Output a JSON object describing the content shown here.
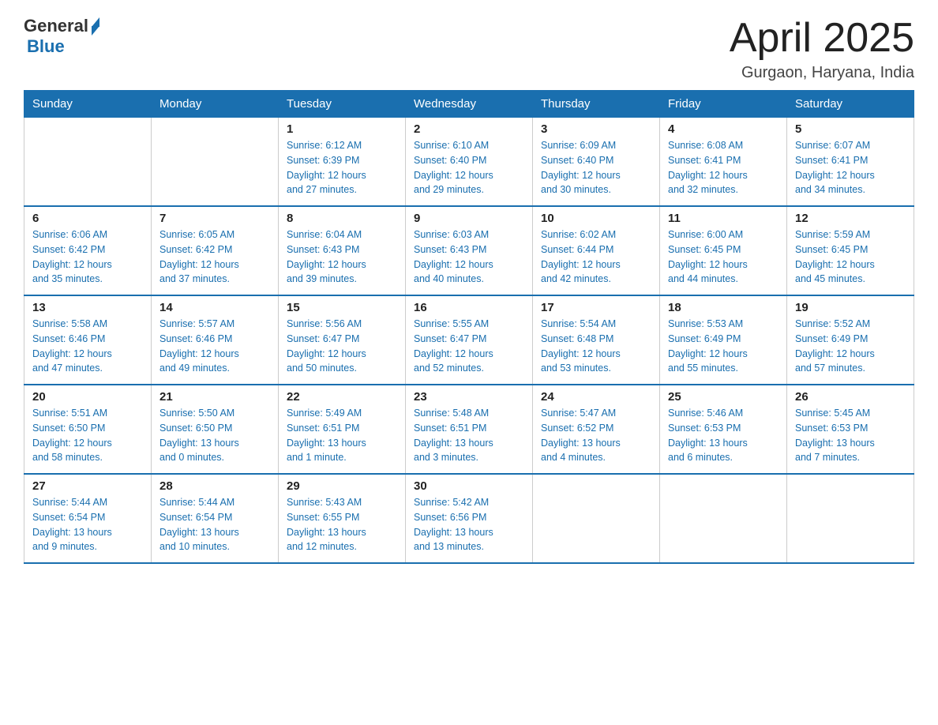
{
  "logo": {
    "general": "General",
    "blue": "Blue"
  },
  "header": {
    "month": "April 2025",
    "location": "Gurgaon, Haryana, India"
  },
  "weekdays": [
    "Sunday",
    "Monday",
    "Tuesday",
    "Wednesday",
    "Thursday",
    "Friday",
    "Saturday"
  ],
  "weeks": [
    [
      {
        "day": "",
        "info": ""
      },
      {
        "day": "",
        "info": ""
      },
      {
        "day": "1",
        "info": "Sunrise: 6:12 AM\nSunset: 6:39 PM\nDaylight: 12 hours\nand 27 minutes."
      },
      {
        "day": "2",
        "info": "Sunrise: 6:10 AM\nSunset: 6:40 PM\nDaylight: 12 hours\nand 29 minutes."
      },
      {
        "day": "3",
        "info": "Sunrise: 6:09 AM\nSunset: 6:40 PM\nDaylight: 12 hours\nand 30 minutes."
      },
      {
        "day": "4",
        "info": "Sunrise: 6:08 AM\nSunset: 6:41 PM\nDaylight: 12 hours\nand 32 minutes."
      },
      {
        "day": "5",
        "info": "Sunrise: 6:07 AM\nSunset: 6:41 PM\nDaylight: 12 hours\nand 34 minutes."
      }
    ],
    [
      {
        "day": "6",
        "info": "Sunrise: 6:06 AM\nSunset: 6:42 PM\nDaylight: 12 hours\nand 35 minutes."
      },
      {
        "day": "7",
        "info": "Sunrise: 6:05 AM\nSunset: 6:42 PM\nDaylight: 12 hours\nand 37 minutes."
      },
      {
        "day": "8",
        "info": "Sunrise: 6:04 AM\nSunset: 6:43 PM\nDaylight: 12 hours\nand 39 minutes."
      },
      {
        "day": "9",
        "info": "Sunrise: 6:03 AM\nSunset: 6:43 PM\nDaylight: 12 hours\nand 40 minutes."
      },
      {
        "day": "10",
        "info": "Sunrise: 6:02 AM\nSunset: 6:44 PM\nDaylight: 12 hours\nand 42 minutes."
      },
      {
        "day": "11",
        "info": "Sunrise: 6:00 AM\nSunset: 6:45 PM\nDaylight: 12 hours\nand 44 minutes."
      },
      {
        "day": "12",
        "info": "Sunrise: 5:59 AM\nSunset: 6:45 PM\nDaylight: 12 hours\nand 45 minutes."
      }
    ],
    [
      {
        "day": "13",
        "info": "Sunrise: 5:58 AM\nSunset: 6:46 PM\nDaylight: 12 hours\nand 47 minutes."
      },
      {
        "day": "14",
        "info": "Sunrise: 5:57 AM\nSunset: 6:46 PM\nDaylight: 12 hours\nand 49 minutes."
      },
      {
        "day": "15",
        "info": "Sunrise: 5:56 AM\nSunset: 6:47 PM\nDaylight: 12 hours\nand 50 minutes."
      },
      {
        "day": "16",
        "info": "Sunrise: 5:55 AM\nSunset: 6:47 PM\nDaylight: 12 hours\nand 52 minutes."
      },
      {
        "day": "17",
        "info": "Sunrise: 5:54 AM\nSunset: 6:48 PM\nDaylight: 12 hours\nand 53 minutes."
      },
      {
        "day": "18",
        "info": "Sunrise: 5:53 AM\nSunset: 6:49 PM\nDaylight: 12 hours\nand 55 minutes."
      },
      {
        "day": "19",
        "info": "Sunrise: 5:52 AM\nSunset: 6:49 PM\nDaylight: 12 hours\nand 57 minutes."
      }
    ],
    [
      {
        "day": "20",
        "info": "Sunrise: 5:51 AM\nSunset: 6:50 PM\nDaylight: 12 hours\nand 58 minutes."
      },
      {
        "day": "21",
        "info": "Sunrise: 5:50 AM\nSunset: 6:50 PM\nDaylight: 13 hours\nand 0 minutes."
      },
      {
        "day": "22",
        "info": "Sunrise: 5:49 AM\nSunset: 6:51 PM\nDaylight: 13 hours\nand 1 minute."
      },
      {
        "day": "23",
        "info": "Sunrise: 5:48 AM\nSunset: 6:51 PM\nDaylight: 13 hours\nand 3 minutes."
      },
      {
        "day": "24",
        "info": "Sunrise: 5:47 AM\nSunset: 6:52 PM\nDaylight: 13 hours\nand 4 minutes."
      },
      {
        "day": "25",
        "info": "Sunrise: 5:46 AM\nSunset: 6:53 PM\nDaylight: 13 hours\nand 6 minutes."
      },
      {
        "day": "26",
        "info": "Sunrise: 5:45 AM\nSunset: 6:53 PM\nDaylight: 13 hours\nand 7 minutes."
      }
    ],
    [
      {
        "day": "27",
        "info": "Sunrise: 5:44 AM\nSunset: 6:54 PM\nDaylight: 13 hours\nand 9 minutes."
      },
      {
        "day": "28",
        "info": "Sunrise: 5:44 AM\nSunset: 6:54 PM\nDaylight: 13 hours\nand 10 minutes."
      },
      {
        "day": "29",
        "info": "Sunrise: 5:43 AM\nSunset: 6:55 PM\nDaylight: 13 hours\nand 12 minutes."
      },
      {
        "day": "30",
        "info": "Sunrise: 5:42 AM\nSunset: 6:56 PM\nDaylight: 13 hours\nand 13 minutes."
      },
      {
        "day": "",
        "info": ""
      },
      {
        "day": "",
        "info": ""
      },
      {
        "day": "",
        "info": ""
      }
    ]
  ]
}
